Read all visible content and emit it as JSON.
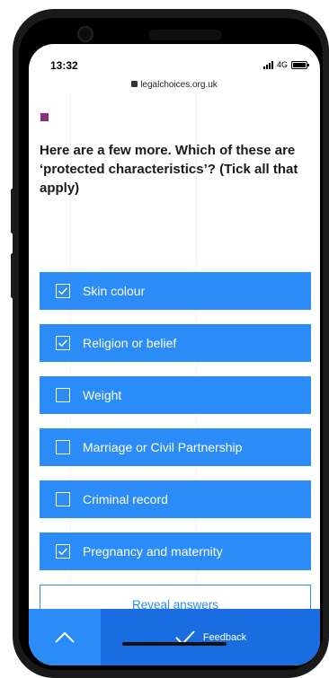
{
  "status_bar": {
    "time": "13:32",
    "network": "4G",
    "battery_level": 1.0
  },
  "browser": {
    "url": "legalchoices.org.uk"
  },
  "question": "Here are a few more. Which of these are ‘protected characteristics’? (Tick all that apply)",
  "options": [
    {
      "label": "Skin colour",
      "checked": true
    },
    {
      "label": "Religion or belief",
      "checked": true
    },
    {
      "label": "Weight",
      "checked": false
    },
    {
      "label": "Marriage or Civil Partnership",
      "checked": false
    },
    {
      "label": "Criminal record",
      "checked": false
    },
    {
      "label": "Pregnancy and maternity",
      "checked": true
    }
  ],
  "reveal_button": "Reveal answers",
  "bottom_bar": {
    "feedback_label": "Feedback",
    "up_icon": "chevron-up-icon",
    "feedback_icon": "checkmark-icon"
  },
  "colors": {
    "option_bg": "#2b8bf7",
    "feedback_bg": "#1a6de0",
    "accent_square": "#8a2c7a"
  }
}
